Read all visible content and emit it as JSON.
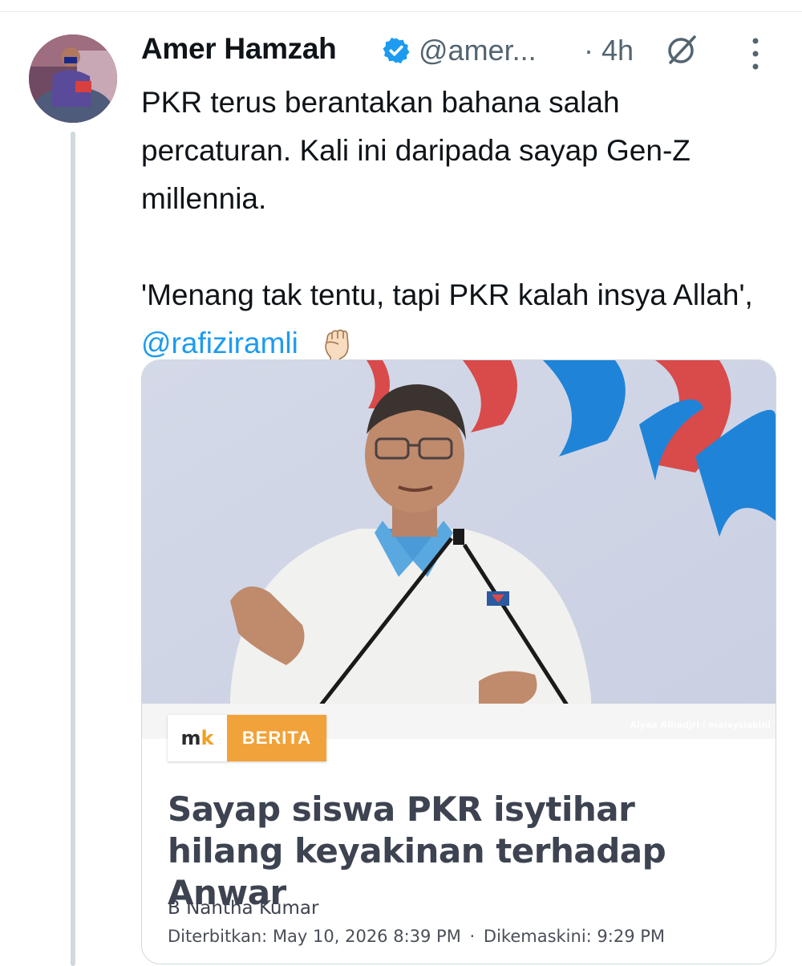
{
  "tweet": {
    "author_name": "Amer Hamzah",
    "handle": "@amer...",
    "time": "· 4h",
    "icons": {
      "verified": "verified-badge-icon",
      "grok": "grok-icon",
      "more": "more-options-icon"
    },
    "text_lines": [
      "PKR terus berantakan bahana salah percaturan. Kali ini daripada sayap Gen-Z millennia."
    ],
    "quote_line": "'Menang tak tentu, tapi PKR kalah insya Allah',",
    "mention": "@rafiziramli",
    "emoji": "raised-fist"
  },
  "card": {
    "image_credit": "Alyaa Alhadjri | malaysiakini",
    "source_logo": {
      "left": "m",
      "right": "k"
    },
    "category": "BERITA",
    "headline": "Sayap siswa PKR isytihar hilang keyakinan terhadap Anwar",
    "byline": "B Nantha Kumar",
    "published_label": "Diterbitkan:",
    "published_value": "May 10, 2026 8:39 PM",
    "separator": "·",
    "updated_label": "Dikemaskini:",
    "updated_value": "9:29 PM"
  },
  "colors": {
    "link": "#1d9bf0",
    "badge": "#f2a23a",
    "verified": "#1d9bf0"
  }
}
